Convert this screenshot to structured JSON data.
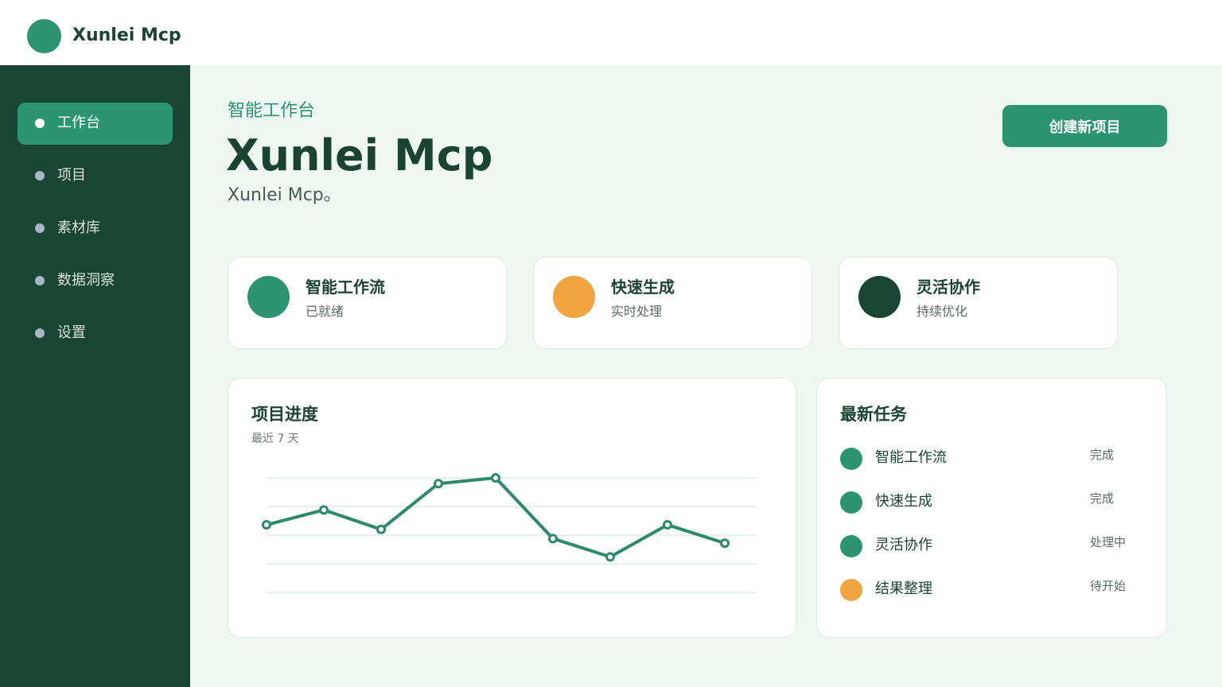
{
  "app": {
    "brand": "Xunlei Mcp"
  },
  "sidebar": {
    "items": [
      {
        "label": "工作台",
        "active": true
      },
      {
        "label": "项目",
        "active": false
      },
      {
        "label": "素材库",
        "active": false
      },
      {
        "label": "数据洞察",
        "active": false
      },
      {
        "label": "设置",
        "active": false
      }
    ]
  },
  "hero": {
    "eyebrow": "智能工作台",
    "title": "Xunlei Mcp",
    "subtitle": "Xunlei Mcp。",
    "cta_label": "创建新项目"
  },
  "stats": [
    {
      "title": "智能工作流",
      "subtitle": "已就绪",
      "color": "#2c9470"
    },
    {
      "title": "快速生成",
      "subtitle": "实时处理",
      "color": "#f0a541"
    },
    {
      "title": "灵活协作",
      "subtitle": "持续优化",
      "color": "#1a4534"
    }
  ],
  "progress_panel": {
    "title": "项目进度",
    "subtitle": "最近 7 天"
  },
  "chart_data": {
    "type": "line",
    "values": [
      59,
      72,
      55,
      95,
      100,
      47,
      31,
      59,
      43
    ],
    "ylim": [
      0,
      100
    ],
    "grid": true,
    "line_color": "#2c8a6a"
  },
  "tasks_panel": {
    "title": "最新任务",
    "items": [
      {
        "name": "智能工作流",
        "status": "完成",
        "color": "#2c9470"
      },
      {
        "name": "快速生成",
        "status": "完成",
        "color": "#2c9470"
      },
      {
        "name": "灵活协作",
        "status": "处理中",
        "color": "#2c9470"
      },
      {
        "name": "结果整理",
        "status": "待开始",
        "color": "#f0a541"
      }
    ]
  },
  "colors": {
    "accent": "#2c9470",
    "sidebar": "#1a4534",
    "warning": "#f0a541",
    "background": "#eef7f2"
  }
}
